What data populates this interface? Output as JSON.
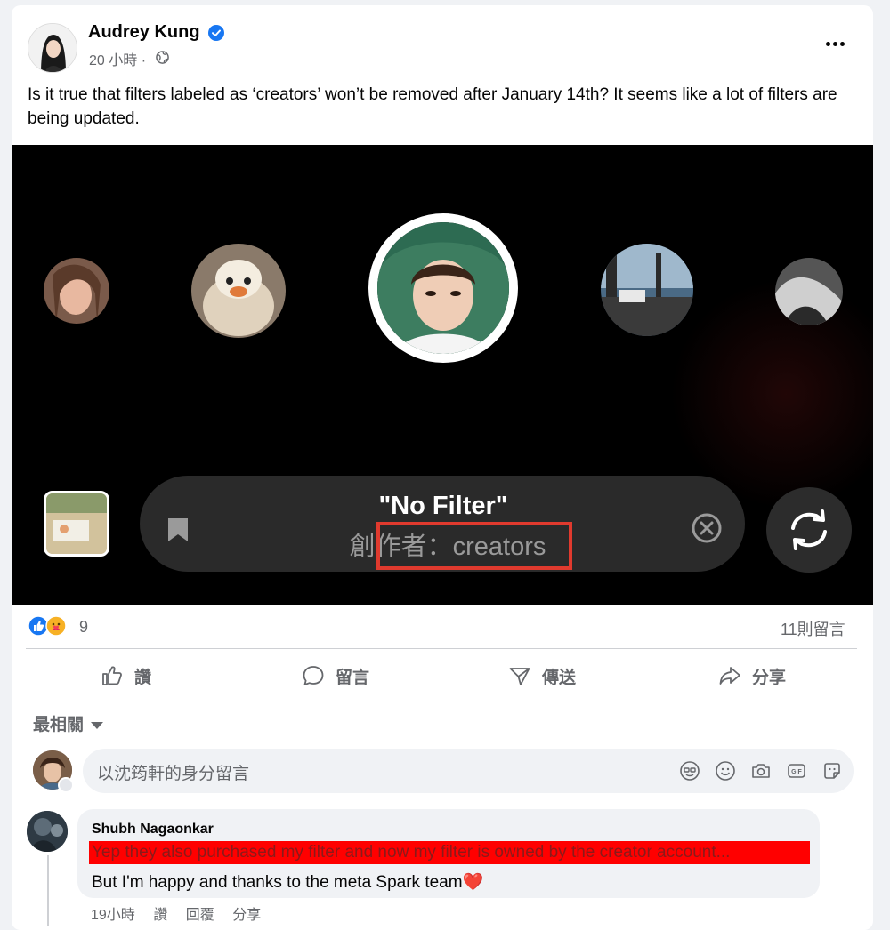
{
  "post": {
    "author": "Audrey Kung",
    "time": "20 小時 ·",
    "text": "Is it true that filters labeled as ‘creators’ won’t be removed after January 14th? It seems like a lot of filters are being updated."
  },
  "media": {
    "filter_name": "\"No Filter\"",
    "filter_author": "創作者：creators"
  },
  "stats": {
    "reaction_count": "9",
    "comment_count": "11則留言"
  },
  "actions": {
    "like": "讚",
    "comment": "留言",
    "send": "傳送",
    "share": "分享"
  },
  "sort": {
    "label": "最相關"
  },
  "composer": {
    "placeholder": "以沈筠軒的身分留言"
  },
  "comment": {
    "author": "Shubh Nagaonkar",
    "line1": "Yep they also purchased my filter and now my filter is owned by the creator account...",
    "line2": "But I'm happy and thanks to the meta Spark team",
    "heart": "❤️",
    "time": "19小時",
    "like": "讚",
    "reply": "回覆",
    "share": "分享"
  },
  "colors": {
    "brand_blue": "#1877f2",
    "highlight_red": "#e03a2e",
    "comment_highlight": "#ff0000"
  }
}
